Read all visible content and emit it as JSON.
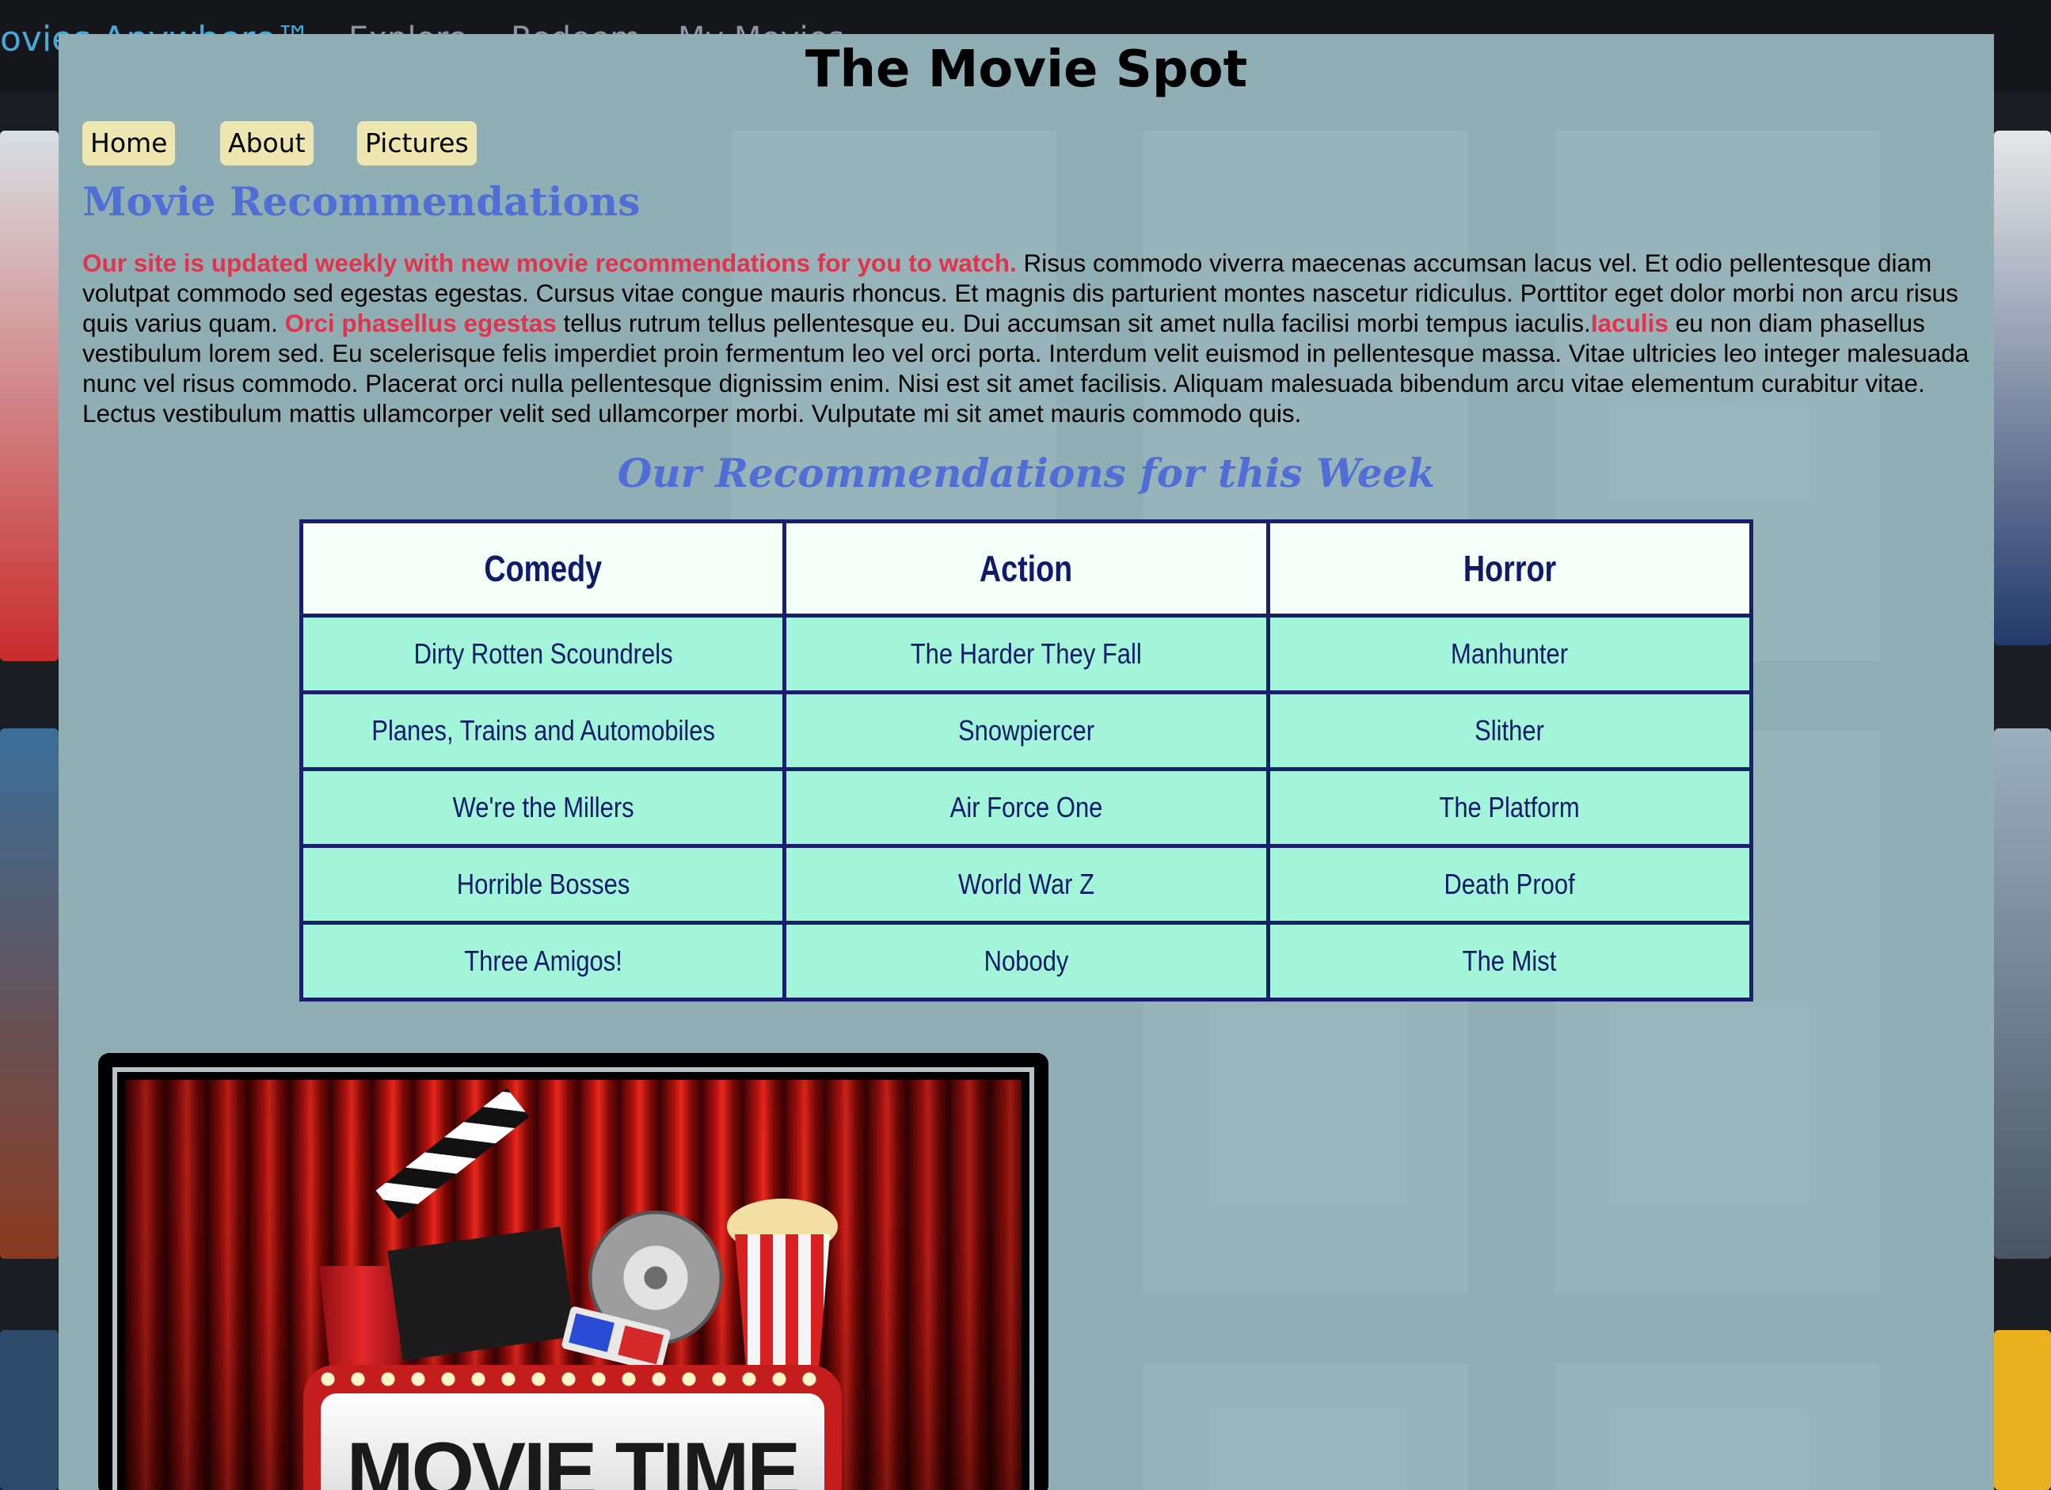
{
  "background_site": {
    "brand": "ovies Anywhere™",
    "nav": [
      "Explore",
      "Redeem",
      "My Movies"
    ]
  },
  "site": {
    "title": "The Movie Spot"
  },
  "nav": {
    "items": [
      {
        "label": "Home"
      },
      {
        "label": "About"
      },
      {
        "label": "Pictures"
      }
    ],
    "button_color": "#eee6b0"
  },
  "main": {
    "heading": "Movie Recommendations",
    "intro": {
      "highlight_1": "Our site is updated weekly with new movie recommendations for you to watch.",
      "text_1": " Risus commodo viverra maecenas accumsan lacus vel. Et odio pellentesque diam volutpat commodo sed egestas egestas. Cursus vitae congue mauris rhoncus. Et magnis dis parturient montes nascetur ridiculus. Porttitor eget dolor morbi non arcu risus quis varius quam. ",
      "highlight_2": "Orci phasellus egestas",
      "text_2": " tellus rutrum tellus pellentesque eu. Dui accumsan sit amet nulla facilisi morbi tempus iaculis.",
      "highlight_3": "Iaculis",
      "text_3": " eu non diam phasellus vestibulum lorem sed. Eu scelerisque felis imperdiet proin fermentum leo vel orci porta. Interdum velit euismod in pellentesque massa. Vitae ultricies leo integer malesuada nunc vel risus commodo. Placerat orci nulla pellentesque dignissim enim. Nisi est sit amet facilisis. Aliquam malesuada bibendum arcu vitae elementum curabitur vitae. Lectus vestibulum mattis ullamcorper velit sed ullamcorper morbi. Vulputate mi sit amet mauris commodo quis."
    },
    "highlight_color": "#e0334c",
    "heading_color": "#4f6fd6"
  },
  "recommendations": {
    "heading": "Our Recommendations for this Week",
    "columns": [
      "Comedy",
      "Action",
      "Horror"
    ],
    "rows": [
      [
        "Dirty Rotten Scoundrels",
        "The Harder They Fall",
        "Manhunter"
      ],
      [
        "Planes, Trains and Automobiles",
        "Snowpiercer",
        "Slither"
      ],
      [
        "We're the Millers",
        "Air Force One",
        "The Platform"
      ],
      [
        "Horrible Bosses",
        "World War Z",
        "Death Proof"
      ],
      [
        "Three Amigos!",
        "Nobody",
        "The Mist"
      ]
    ],
    "header_bg": "#f5fff9",
    "cell_bg": "#a3f5d9",
    "border_color": "#1a1f6b"
  },
  "promo_image": {
    "sign_text": "MOVIE TIME"
  }
}
